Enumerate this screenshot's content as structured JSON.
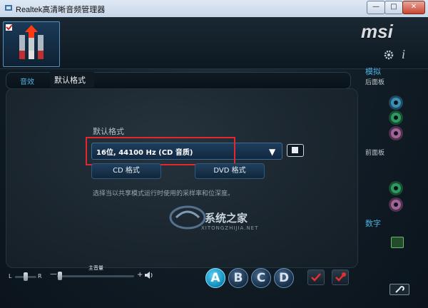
{
  "window": {
    "title": "Realtek高清晰音频管理器",
    "min_label": "—",
    "max_label": "□",
    "close_label": "✕"
  },
  "brand": {
    "logo_text": "msi"
  },
  "header": {
    "info_icon": "i"
  },
  "tabs": [
    {
      "label": "音效",
      "active": false
    },
    {
      "label": "默认格式",
      "active": true
    }
  ],
  "default_format": {
    "section_title": "默认格式",
    "selected_value": "16位, 44100 Hz (CD 音质)",
    "cd_button": "CD 格式",
    "dvd_button": "DVD 格式",
    "description": "选择当以共享模式运行时使用的采样率和位深度。"
  },
  "sidebar": {
    "analog_label": "模拟",
    "back_panel_label": "后面板",
    "front_panel_label": "前面板",
    "digital_label": "数字",
    "jack_colors": {
      "blue": "#3d8fb8",
      "green": "#2f9a5f",
      "pink": "#a0649a"
    }
  },
  "volume": {
    "label": "主音量",
    "left_label": "L",
    "right_label": "R",
    "minus": "—",
    "plus": "+",
    "balance_level": 0.5,
    "volume_level": 0.04
  },
  "profiles": [
    "A",
    "B",
    "C",
    "D"
  ],
  "watermark": {
    "text": "系统之家",
    "sub": "XITONGZHIJIA.NET"
  },
  "colors": {
    "accent": "#4fb3e3",
    "highlight_box": "#e4272c",
    "profile_active": "#1895c5"
  }
}
